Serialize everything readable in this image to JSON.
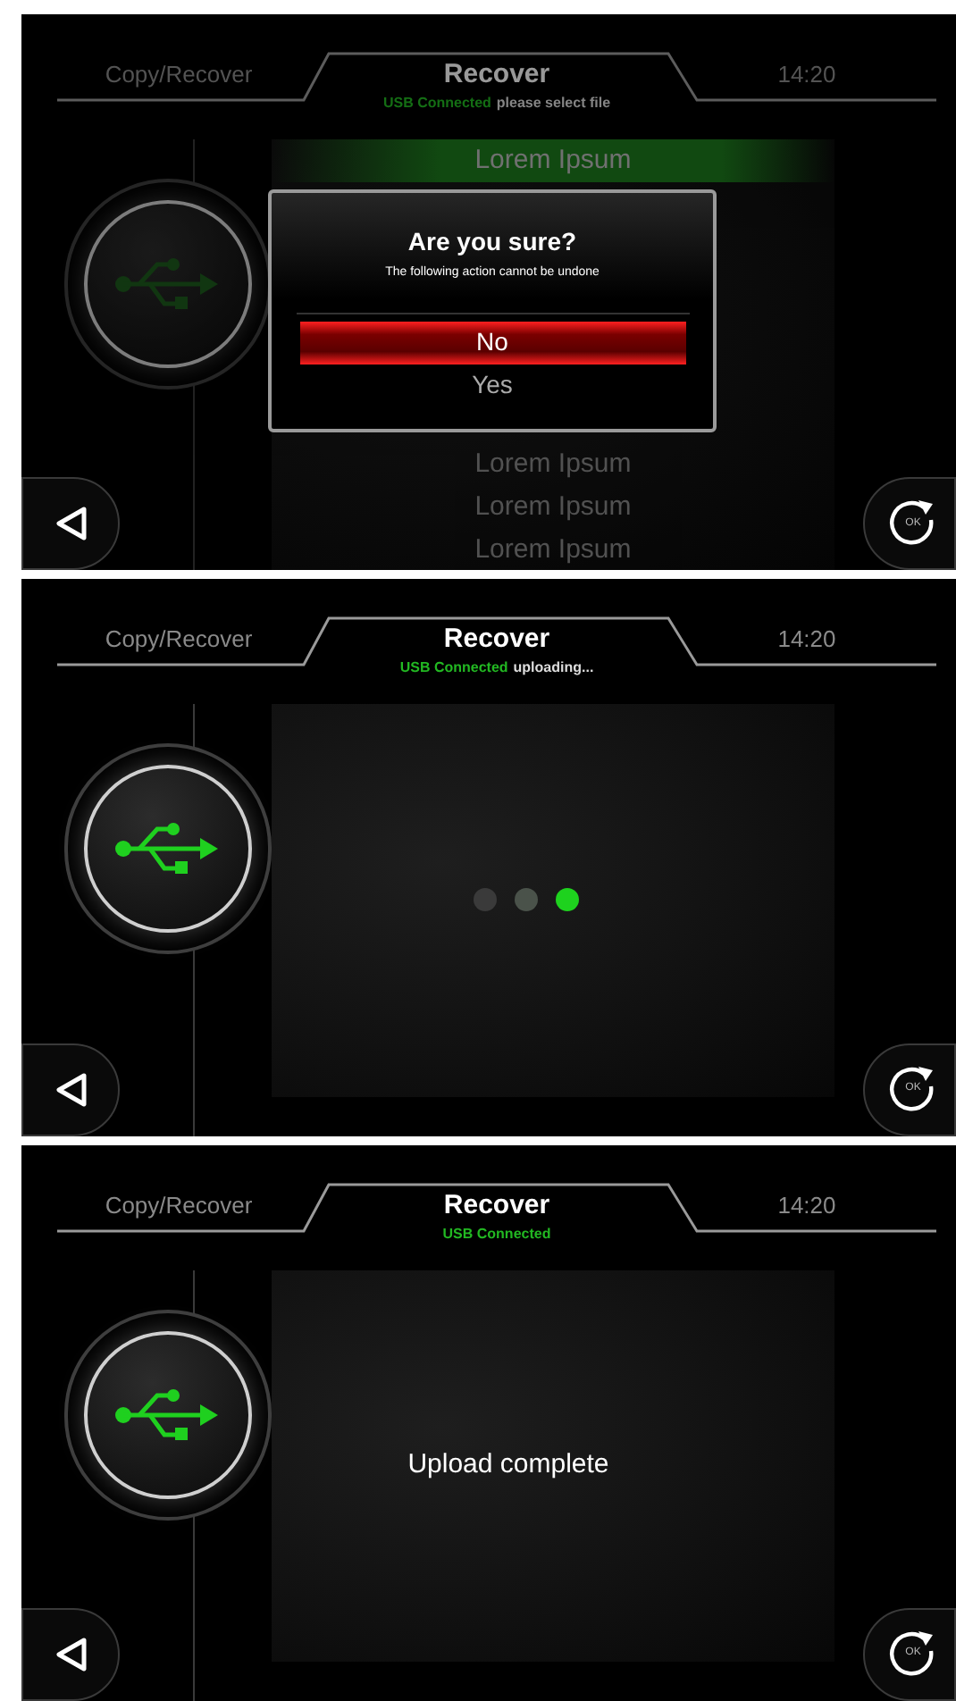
{
  "screens": [
    {
      "kind": "select",
      "dimmed": true,
      "header": {
        "section": "Copy/Recover",
        "title": "Recover",
        "time": "14:20"
      },
      "status": {
        "connected": "USB Connected",
        "message": "please select file"
      },
      "files": [
        {
          "name": "Lorem Ipsum",
          "selected": true
        },
        {
          "name": "Lorem Ipsum",
          "selected": false
        },
        {
          "name": "Lorem Ipsum",
          "selected": false
        },
        {
          "name": "Lorem Ipsum",
          "selected": false
        }
      ],
      "dialog": {
        "title": "Are you sure?",
        "message": "The following action cannot be undone",
        "options": [
          {
            "label": "No",
            "selected": true
          },
          {
            "label": "Yes",
            "selected": false
          }
        ]
      },
      "ok_label": "OK"
    },
    {
      "kind": "uploading",
      "dimmed": false,
      "header": {
        "section": "Copy/Recover",
        "title": "Recover",
        "time": "14:20"
      },
      "status": {
        "connected": "USB Connected",
        "message": "uploading..."
      },
      "dots": [
        {
          "color": "#3a3a3a"
        },
        {
          "color": "#4a524a"
        },
        {
          "color": "#1ed21e"
        }
      ],
      "ok_label": "OK"
    },
    {
      "kind": "complete",
      "dimmed": false,
      "header": {
        "section": "Copy/Recover",
        "title": "Recover",
        "time": "14:20"
      },
      "status": {
        "connected": "USB Connected"
      },
      "message": "Upload complete",
      "ok_label": "OK"
    }
  ]
}
